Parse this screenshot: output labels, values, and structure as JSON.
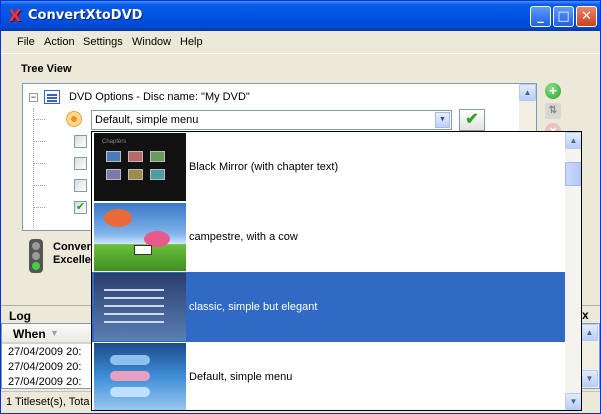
{
  "window": {
    "title": "ConvertXtoDVD",
    "app_icon": "X",
    "controls": [
      "minimize",
      "maximize",
      "close"
    ]
  },
  "menubar": [
    "File",
    "Action",
    "Settings",
    "Window",
    "Help"
  ],
  "tree_view": {
    "label": "Tree View",
    "root_label": "DVD Options - Disc name: \"My DVD\"",
    "menu_combo_value": "Default, simple menu",
    "checkboxes": [
      false,
      false,
      false,
      true
    ]
  },
  "status": {
    "line1": "Conver",
    "line2": "Excelle"
  },
  "dropdown": {
    "items": [
      {
        "label": "Black Mirror (with chapter text)",
        "selected": false,
        "thumb": "black"
      },
      {
        "label": "campestre, with a cow",
        "selected": false,
        "thumb": "sky"
      },
      {
        "label": "classic, simple but elegant",
        "selected": true,
        "thumb": "blue"
      },
      {
        "label": "Default, simple menu",
        "selected": false,
        "thumb": "grad"
      }
    ]
  },
  "log": {
    "title": "Log",
    "close_label": "x",
    "column_when": "When",
    "rows": [
      "27/04/2009 20:",
      "27/04/2009 20:",
      "27/04/2009 20:"
    ]
  },
  "statusbar": {
    "left": "1 Titleset(s), Tota"
  },
  "colors": {
    "titlebar": "#0054e3",
    "selection": "#316ac5",
    "window_bg": "#ece9d8"
  }
}
